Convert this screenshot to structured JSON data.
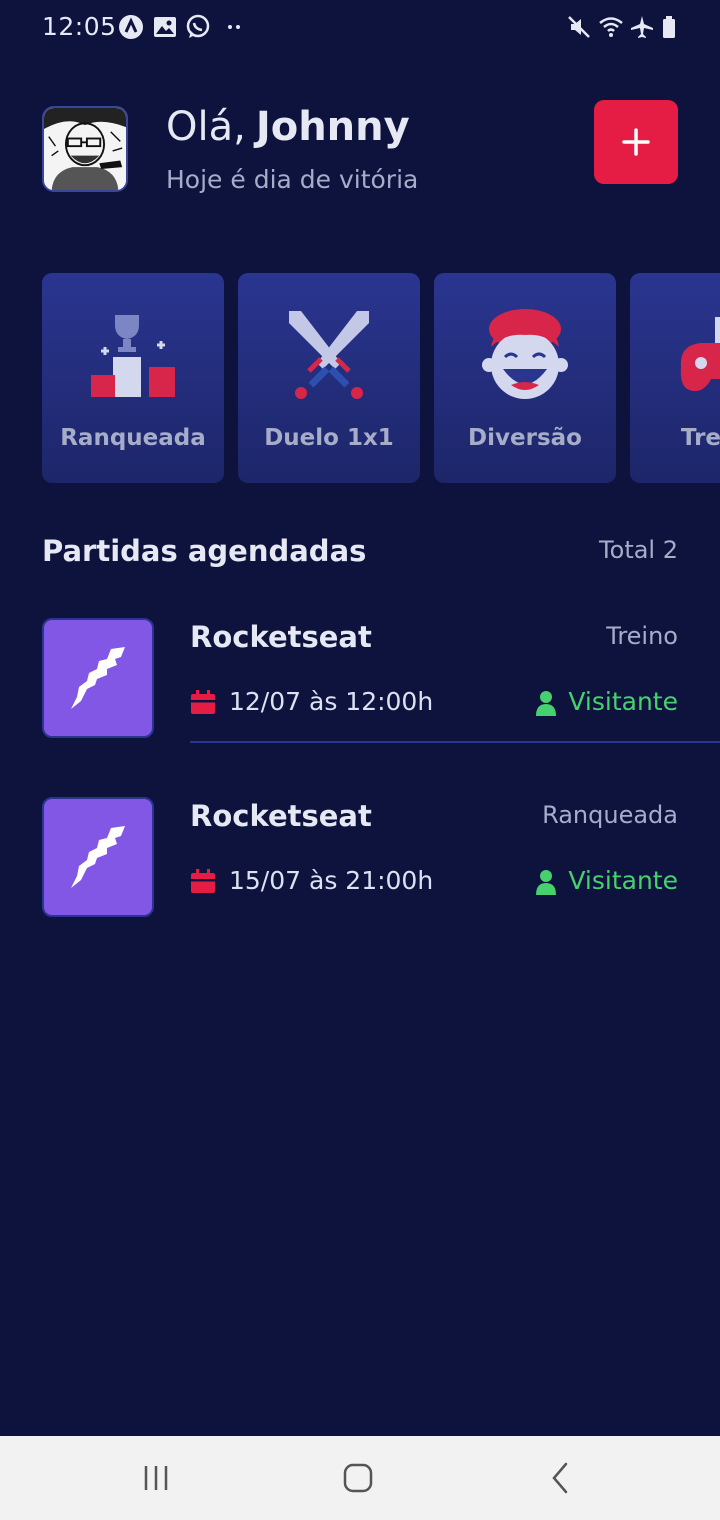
{
  "status_bar": {
    "time": "12:05",
    "left_icons": [
      "nucleo-icon",
      "gallery-icon",
      "whatsapp-icon",
      "more-dots-icon"
    ],
    "right_icons": [
      "mute-icon",
      "wifi-icon",
      "airplane-icon",
      "battery-icon"
    ]
  },
  "header": {
    "greeting": "Olá,",
    "user_name": "Johnny",
    "subtitle": "Hoje é dia de vitória",
    "add_button_icon": "plus-icon"
  },
  "categories": [
    {
      "label": "Ranqueada",
      "icon": "trophy-podium-icon"
    },
    {
      "label": "Duelo 1x1",
      "icon": "crossed-swords-icon"
    },
    {
      "label": "Diversão",
      "icon": "laughing-face-icon"
    },
    {
      "label": "Treino",
      "icon": "gamepad-icon"
    }
  ],
  "section": {
    "title": "Partidas agendadas",
    "total": "Total 2"
  },
  "matches": [
    {
      "guild": "Rocketseat",
      "category": "Treino",
      "date": "12/07 às 12:00h",
      "role": "Visitante"
    },
    {
      "guild": "Rocketseat",
      "category": "Ranqueada",
      "date": "15/07 às 21:00h",
      "role": "Visitante"
    }
  ],
  "nav_bar": {
    "icons": [
      "recent-apps-icon",
      "home-icon",
      "back-icon"
    ]
  },
  "colors": {
    "background": "#0d133d",
    "card": "#2a3590",
    "accent_red": "#e51c44",
    "thumb_purple": "#8257e5",
    "visitor_green": "#47d16e",
    "text_muted": "#a7acc9"
  }
}
